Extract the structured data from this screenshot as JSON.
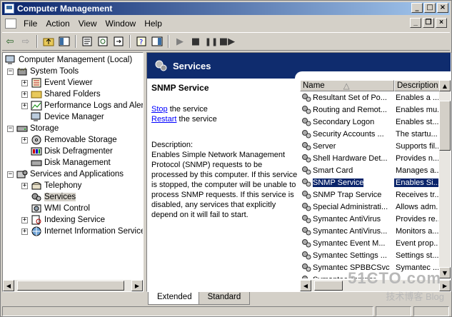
{
  "window": {
    "title": "Computer Management"
  },
  "menu": {
    "items": [
      "File",
      "Action",
      "View",
      "Window",
      "Help"
    ]
  },
  "tree": {
    "root": "Computer Management (Local)",
    "items": [
      {
        "label": "System Tools",
        "expander": "−"
      },
      {
        "label": "Event Viewer",
        "expander": "+"
      },
      {
        "label": "Shared Folders",
        "expander": "+"
      },
      {
        "label": "Performance Logs and Alerts",
        "expander": "+"
      },
      {
        "label": "Device Manager",
        "expander": ""
      },
      {
        "label": "Storage",
        "expander": "−"
      },
      {
        "label": "Removable Storage",
        "expander": "+"
      },
      {
        "label": "Disk Defragmenter",
        "expander": ""
      },
      {
        "label": "Disk Management",
        "expander": ""
      },
      {
        "label": "Services and Applications",
        "expander": "−"
      },
      {
        "label": "Telephony",
        "expander": "+"
      },
      {
        "label": "Services",
        "expander": ""
      },
      {
        "label": "WMI Control",
        "expander": ""
      },
      {
        "label": "Indexing Service",
        "expander": "+"
      },
      {
        "label": "Internet Information Services",
        "expander": "+"
      }
    ]
  },
  "services_pane": {
    "header": "Services",
    "selected_service": "SNMP Service",
    "stop_link": "Stop",
    "stop_rest": " the service",
    "restart_link": "Restart",
    "restart_rest": " the service",
    "description_label": "Description:",
    "description_text": "Enables Simple Network Management Protocol (SNMP) requests to be processed by this computer. If this service is stopped, the computer will be unable to process SNMP requests. If this service is disabled, any services that explicitly depend on it will fail to start."
  },
  "list": {
    "columns": [
      "Name",
      "Description"
    ],
    "rows": [
      {
        "name": "Resultant Set of Po...",
        "desc": "Enables a ..."
      },
      {
        "name": "Routing and Remot...",
        "desc": "Enables mu..."
      },
      {
        "name": "Secondary Logon",
        "desc": "Enables st..."
      },
      {
        "name": "Security Accounts ...",
        "desc": "The startu..."
      },
      {
        "name": "Server",
        "desc": "Supports fil..."
      },
      {
        "name": "Shell Hardware Det...",
        "desc": "Provides n..."
      },
      {
        "name": "Smart Card",
        "desc": "Manages a..."
      },
      {
        "name": "SNMP Service",
        "desc": "Enables Si..."
      },
      {
        "name": "SNMP Trap Service",
        "desc": "Receives tr..."
      },
      {
        "name": "Special Administrati...",
        "desc": "Allows adm..."
      },
      {
        "name": "Symantec AntiVirus",
        "desc": "Provides re..."
      },
      {
        "name": "Symantec AntiVirus...",
        "desc": "Monitors a..."
      },
      {
        "name": "Symantec Event M...",
        "desc": "Event prop..."
      },
      {
        "name": "Symantec Settings ...",
        "desc": "Settings st..."
      },
      {
        "name": "Symantec SPBBCSvc",
        "desc": "Symantec ..."
      },
      {
        "name": "Symantec Tamper ...",
        "desc": ""
      }
    ],
    "selected_index": 7
  },
  "tabs": {
    "extended": "Extended",
    "standard": "Standard"
  },
  "watermark": {
    "line1": "51CTO.com",
    "line2": "技术博客  Blog"
  }
}
